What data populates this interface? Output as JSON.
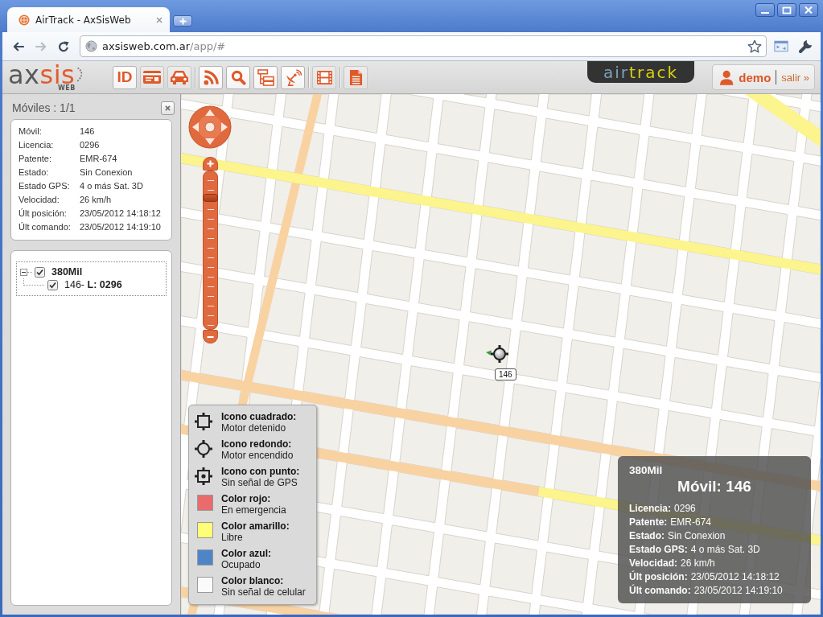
{
  "browser": {
    "tab_title": "AirTrack - AxSisWeb",
    "navigation": [
      {
        "kind": "back",
        "disabled": false
      },
      {
        "kind": "forward",
        "disabled": true
      },
      {
        "kind": "reload",
        "disabled": false
      }
    ],
    "address": {
      "host": "axsisweb.com.ar",
      "path": "/app/#"
    }
  },
  "toolbar": {
    "logo": {
      "part1": "ax",
      "part2": "sis",
      "subtitle": "WEB"
    },
    "groups": [
      {
        "buttons": [
          {
            "kind": "id",
            "label": "ID",
            "on": true
          },
          {
            "kind": "card",
            "on": false
          },
          {
            "kind": "car",
            "on": false
          }
        ]
      },
      {
        "buttons": [
          {
            "kind": "rss",
            "on": true
          },
          {
            "kind": "search",
            "on": true
          },
          {
            "kind": "tree",
            "on": true
          },
          {
            "kind": "help",
            "on": true
          }
        ]
      },
      {
        "buttons": [
          {
            "kind": "film",
            "on": false
          }
        ]
      },
      {
        "buttons": [
          {
            "kind": "document",
            "on": false
          }
        ]
      }
    ],
    "brand": {
      "part1": "air",
      "part2": "track"
    },
    "user": {
      "name": "demo",
      "logout": "salir »"
    }
  },
  "panel": {
    "title": "Móviles : 1/1",
    "details": [
      {
        "label": "Móvil:",
        "value": "146"
      },
      {
        "label": "Licencia:",
        "value": "0296"
      },
      {
        "label": "Patente:",
        "value": "EMR-674"
      },
      {
        "label": "Estado:",
        "value": "Sin Conexion"
      },
      {
        "label": "Estado GPS:",
        "value": "4 o más Sat. 3D"
      },
      {
        "label": "Velocidad:",
        "value": "26 km/h"
      },
      {
        "label": "Últ posición:",
        "value": "23/05/2012 14:18:12"
      },
      {
        "label": "Últ comando:",
        "value": "23/05/2012 14:19:10"
      }
    ],
    "tree": [
      {
        "label": "380Mil",
        "checked": true,
        "expanded": true,
        "children": [
          {
            "label": "146- **L: 0296**",
            "checked": true
          }
        ]
      }
    ]
  },
  "map": {
    "zoom": {
      "level": 0.85
    },
    "marker": {
      "label": "146",
      "engine_on": true,
      "gps_signal": true
    },
    "legend": [
      {
        "kind": "square",
        "title": "Icono cuadrado:",
        "description": "Motor detenido"
      },
      {
        "kind": "round",
        "title": "Icono redondo:",
        "description": "Motor encendido"
      },
      {
        "kind": "dot",
        "title": "Icono con punto:",
        "description": "Sin señal de GPS"
      },
      {
        "kind": "swatch",
        "color": "#e96b6b",
        "title": "Color rojo:",
        "description": "En emergencia"
      },
      {
        "kind": "swatch",
        "color": "#fefe78",
        "title": "Color amarillo:",
        "description": "Libre"
      },
      {
        "kind": "swatch",
        "color": "#4f85c6",
        "title": "Color azul:",
        "description": "Ocupado"
      },
      {
        "kind": "swatch",
        "color": "#fafafa",
        "title": "Color blanco:",
        "description": "Sin señal de celular"
      }
    ],
    "info": {
      "group": "380Mil",
      "title": "Móvil: 146",
      "rows": [
        {
          "label": "Licencia:",
          "value": "0296"
        },
        {
          "label": "Patente:",
          "value": "EMR-674"
        },
        {
          "label": "Estado:",
          "value": "Sin Conexion"
        },
        {
          "label": "Estado GPS:",
          "value": "4 o más Sat. 3D"
        },
        {
          "label": "Velocidad:",
          "value": "26 km/h"
        },
        {
          "label": "Últ posición:",
          "value": "23/05/2012 14:18:12"
        },
        {
          "label": "Últ comando:",
          "value": "23/05/2012 14:19:10"
        }
      ]
    }
  }
}
